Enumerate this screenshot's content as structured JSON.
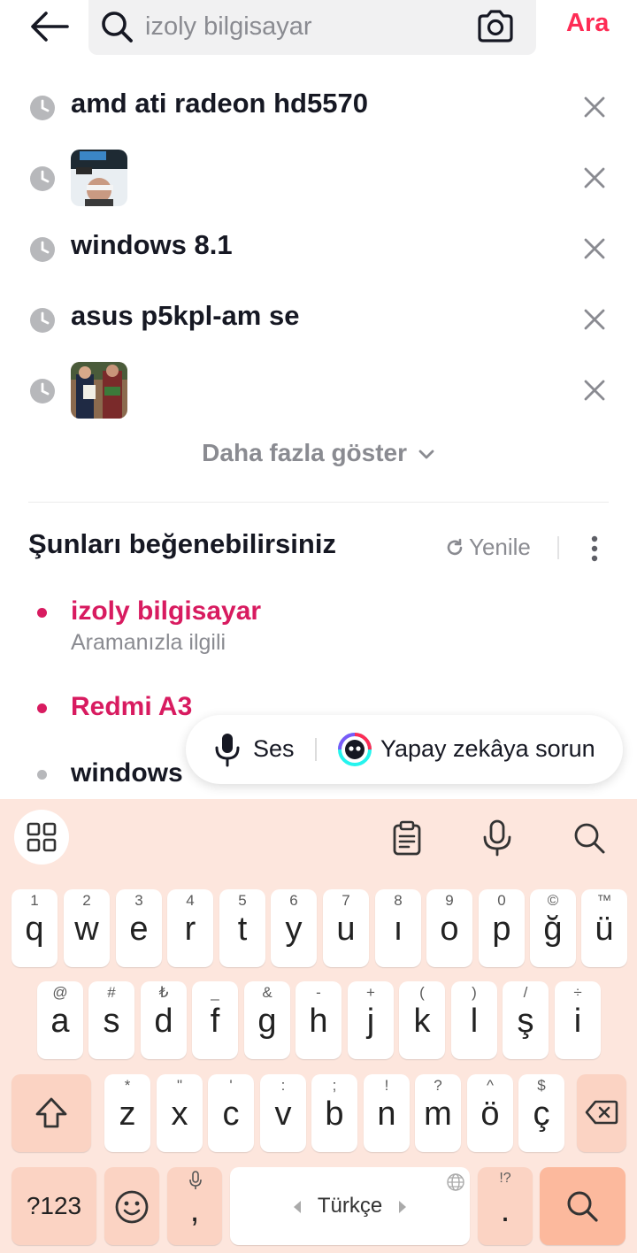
{
  "search": {
    "value": "",
    "placeholder": "izoly bilgisayar",
    "submit_label": "Ara"
  },
  "history": [
    {
      "text": "amd ati radeon hd5570",
      "type": "text"
    },
    {
      "text": "",
      "type": "image"
    },
    {
      "text": "windows 8.1",
      "type": "text"
    },
    {
      "text": "asus p5kpl-am se",
      "type": "text"
    },
    {
      "text": "",
      "type": "image"
    }
  ],
  "show_more_label": "Daha fazla göster",
  "suggestions": {
    "title": "Şunları beğenebilirsiniz",
    "refresh_label": "Yenile",
    "items": [
      {
        "text": "izoly bilgisayar",
        "subtitle": "Aramanızla ilgili",
        "highlight": true
      },
      {
        "text": "Redmi A3",
        "subtitle": "",
        "highlight": true
      },
      {
        "text": "windows",
        "subtitle": "",
        "highlight": false
      }
    ]
  },
  "assistant": {
    "voice_label": "Ses",
    "ai_label": "Yapay zekâya sorun"
  },
  "keyboard": {
    "row1": [
      {
        "main": "q",
        "hint": "1"
      },
      {
        "main": "w",
        "hint": "2"
      },
      {
        "main": "e",
        "hint": "3"
      },
      {
        "main": "r",
        "hint": "4"
      },
      {
        "main": "t",
        "hint": "5"
      },
      {
        "main": "y",
        "hint": "6"
      },
      {
        "main": "u",
        "hint": "7"
      },
      {
        "main": "ı",
        "hint": "8"
      },
      {
        "main": "o",
        "hint": "9"
      },
      {
        "main": "p",
        "hint": "0"
      },
      {
        "main": "ğ",
        "hint": "©"
      },
      {
        "main": "ü",
        "hint": "™"
      }
    ],
    "row2": [
      {
        "main": "a",
        "hint": "@"
      },
      {
        "main": "s",
        "hint": "#"
      },
      {
        "main": "d",
        "hint": "₺"
      },
      {
        "main": "f",
        "hint": "_"
      },
      {
        "main": "g",
        "hint": "&"
      },
      {
        "main": "h",
        "hint": "-"
      },
      {
        "main": "j",
        "hint": "+"
      },
      {
        "main": "k",
        "hint": "("
      },
      {
        "main": "l",
        "hint": ")"
      },
      {
        "main": "ş",
        "hint": "/"
      },
      {
        "main": "i",
        "hint": "÷"
      }
    ],
    "row3": [
      {
        "main": "z",
        "hint": "*"
      },
      {
        "main": "x",
        "hint": "\""
      },
      {
        "main": "c",
        "hint": "'"
      },
      {
        "main": "v",
        "hint": ":"
      },
      {
        "main": "b",
        "hint": ";"
      },
      {
        "main": "n",
        "hint": "!"
      },
      {
        "main": "m",
        "hint": "?"
      },
      {
        "main": "ö",
        "hint": "^"
      },
      {
        "main": "ç",
        "hint": "$"
      }
    ],
    "symbols_label": "?123",
    "comma": ",",
    "space_label": "Türkçe",
    "period": ".",
    "period_hint": "!?"
  },
  "colors": {
    "accent": "#fe2c55",
    "suggestion_highlight": "#d81b60",
    "keyboard_bg": "#fde6dd",
    "key_dark": "#fbd3c3",
    "key_accent": "#fcb99d"
  }
}
